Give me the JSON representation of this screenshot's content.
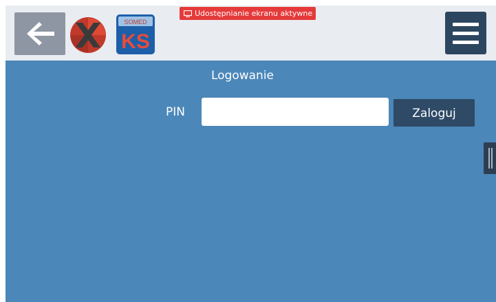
{
  "header": {
    "back_icon": "arrow-left-icon",
    "logo_x_icon": "x-logo-icon",
    "logo_ks_icon": "somed-ks-logo-icon",
    "logo_ks_top_text": "SOMED",
    "logo_ks_text": "KS",
    "menu_icon": "hamburger-menu-icon"
  },
  "share_badge": {
    "icon": "screen-share-icon",
    "text": "Udostępnianie ekranu aktywne",
    "color": "#e53a3a"
  },
  "login": {
    "title": "Logowanie",
    "pin_label": "PIN",
    "pin_value": "",
    "button_label": "Zaloguj"
  },
  "colors": {
    "header_bg": "#e9ecf1",
    "main_bg": "#4b87b9",
    "dark_button": "#2e4a66"
  }
}
